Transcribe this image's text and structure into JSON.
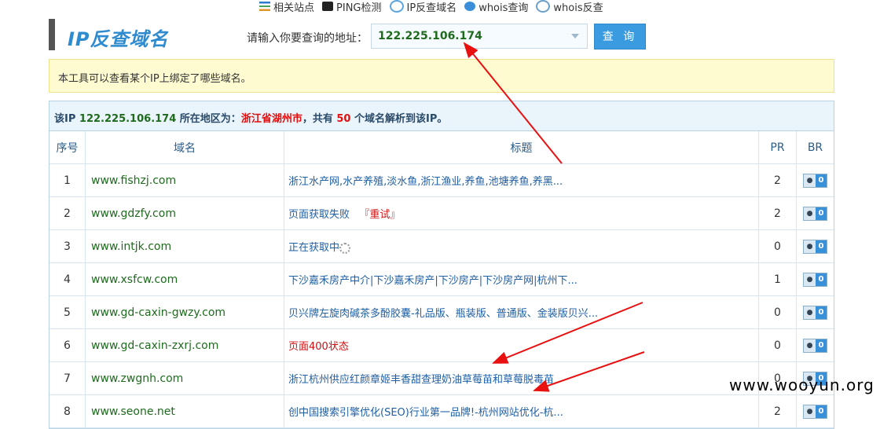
{
  "topnav": [
    {
      "label": "相关站点",
      "icon": "list-icon"
    },
    {
      "label": "PING检测",
      "icon": "ping-icon"
    },
    {
      "label": "IP反查域名",
      "icon": "ip-lookup-icon"
    },
    {
      "label": "whois查询",
      "icon": "whois-icon"
    },
    {
      "label": "whois反查",
      "icon": "whois-reverse-icon"
    }
  ],
  "header": {
    "title": "IP反查域名",
    "search_label": "请输入你要查询的地址：",
    "search_value": "122.225.106.174",
    "query_button": "查 询"
  },
  "notice": "本工具可以查看某个IP上绑定了哪些域名。",
  "summary": {
    "prefix": "该IP ",
    "ip": "122.225.106.174",
    "mid": " 所在地区为：",
    "region": "浙江省湖州市",
    "mid2": "，共有 ",
    "count": "50",
    "suffix": " 个域名解析到该IP。"
  },
  "table": {
    "headers": {
      "num": "序号",
      "domain": "域名",
      "title": "标题",
      "pr": "PR",
      "br": "BR"
    },
    "rows": [
      {
        "num": "1",
        "domain": "www.fishzj.com",
        "title": "浙江水产网,水产养殖,淡水鱼,浙江渔业,养鱼,池塘养鱼,养黑...",
        "pr": "2",
        "br": "0"
      },
      {
        "num": "2",
        "domain": "www.gdzfy.com",
        "title": "页面获取失败",
        "retry": "『重试』",
        "pr": "2",
        "br": "0"
      },
      {
        "num": "3",
        "domain": "www.intjk.com",
        "title": "正在获取中",
        "loading": true,
        "pr": "0",
        "br": "0"
      },
      {
        "num": "4",
        "domain": "www.xsfcw.com",
        "title": "下沙嘉禾房产中介|下沙嘉禾房产|下沙房产|下沙房产网|杭州下...",
        "pr": "1",
        "br": "0"
      },
      {
        "num": "5",
        "domain": "www.gd-caxin-gwzy.com",
        "title": "贝兴牌左旋肉碱茶多酚胶囊-礼品版、瓶装版、普通版、金装版贝兴...",
        "pr": "0",
        "br": "0"
      },
      {
        "num": "6",
        "domain": "www.gd-caxin-zxrj.com",
        "title": "页面400状态",
        "error": true,
        "pr": "0",
        "br": "0"
      },
      {
        "num": "7",
        "domain": "www.zwgnh.com",
        "title": "浙江杭州供应红颜章姬丰香甜查理奶油草莓苗和草莓脱毒苗",
        "pr": "0",
        "br": "0"
      },
      {
        "num": "8",
        "domain": "www.seone.net",
        "title": "创中国搜索引擎优化(SEO)行业第一品牌!-杭州网站优化-杭...",
        "pr": "2",
        "br": "0"
      }
    ]
  },
  "watermark": "www.wooyun.org",
  "colors": {
    "accent": "#2f8bd0",
    "domain_green": "#1e6b1e",
    "highlight_red": "#e01010",
    "arrow_red": "#e81010"
  }
}
